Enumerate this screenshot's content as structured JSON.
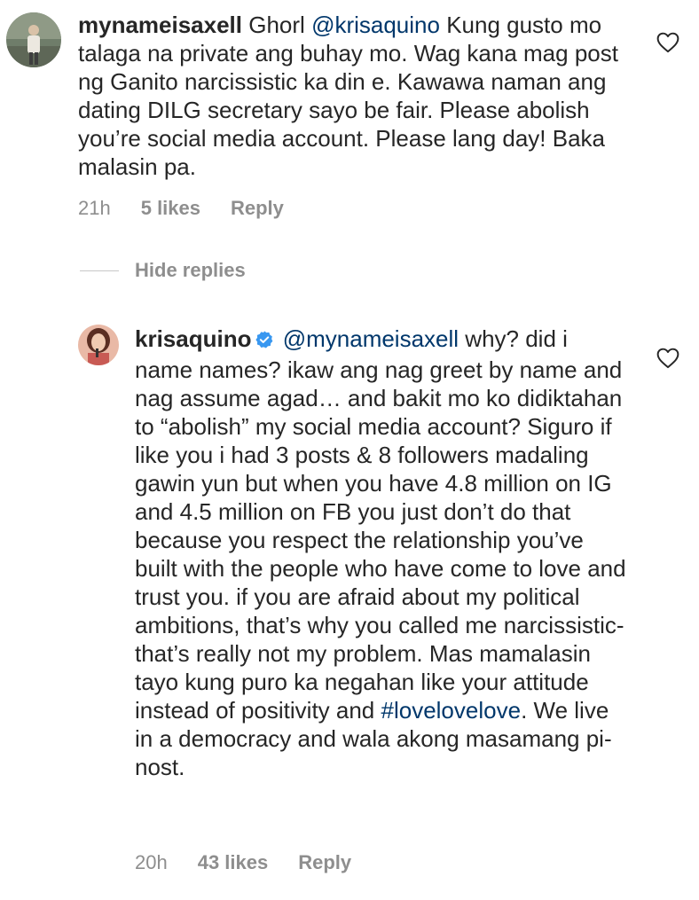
{
  "comments": [
    {
      "username": "mynameisaxell",
      "segments": [
        {
          "type": "text",
          "text": "Ghorl "
        },
        {
          "type": "mention",
          "text": "@krisaquino"
        },
        {
          "type": "text",
          "text": " Kung gusto mo talaga na private ang buhay mo. Wag kana mag post ng Ganito narcissistic ka din e. Kawawa naman ang dating DILG secretary sayo be fair. Please abolish you’re social media account. Please lang day! Baka malasin pa."
        }
      ],
      "time": "21h",
      "likes": "5 likes",
      "reply_label": "Reply"
    }
  ],
  "replies_toggle": {
    "label": "Hide replies"
  },
  "replies": [
    {
      "username": "krisaquino",
      "verified": true,
      "segments": [
        {
          "type": "mention",
          "text": "@mynameisaxell"
        },
        {
          "type": "text",
          "text": " why? did i name names? ikaw ang nag greet by name and nag assume agad… and bakit mo ko didiktahan to “abolish” my social media account? Siguro if like you i had 3 posts & 8 followers madaling gawin yun but when you have 4.8 million on IG and 4.5 million on FB you just don’t do that because you respect the relationship you’ve built with the people who have come to love and trust you. if you are afraid about my political ambitions, that’s why you called me narcissistic- that’s really not my problem. Mas mamalasin tayo kung puro ka negahan like your attitude instead of positivity and "
        },
        {
          "type": "hashtag",
          "text": "#lovelovelove"
        },
        {
          "type": "text",
          "text": ". We live in a democracy and wala akong masamang pi-nost."
        }
      ],
      "time": "20h",
      "likes": "43 likes",
      "reply_label": "Reply"
    }
  ],
  "icons": {
    "like": "heart-outline-icon",
    "verified": "verified-badge-icon"
  },
  "colors": {
    "link": "#00376b",
    "meta": "#8e8e8e",
    "verified": "#3897f0"
  }
}
